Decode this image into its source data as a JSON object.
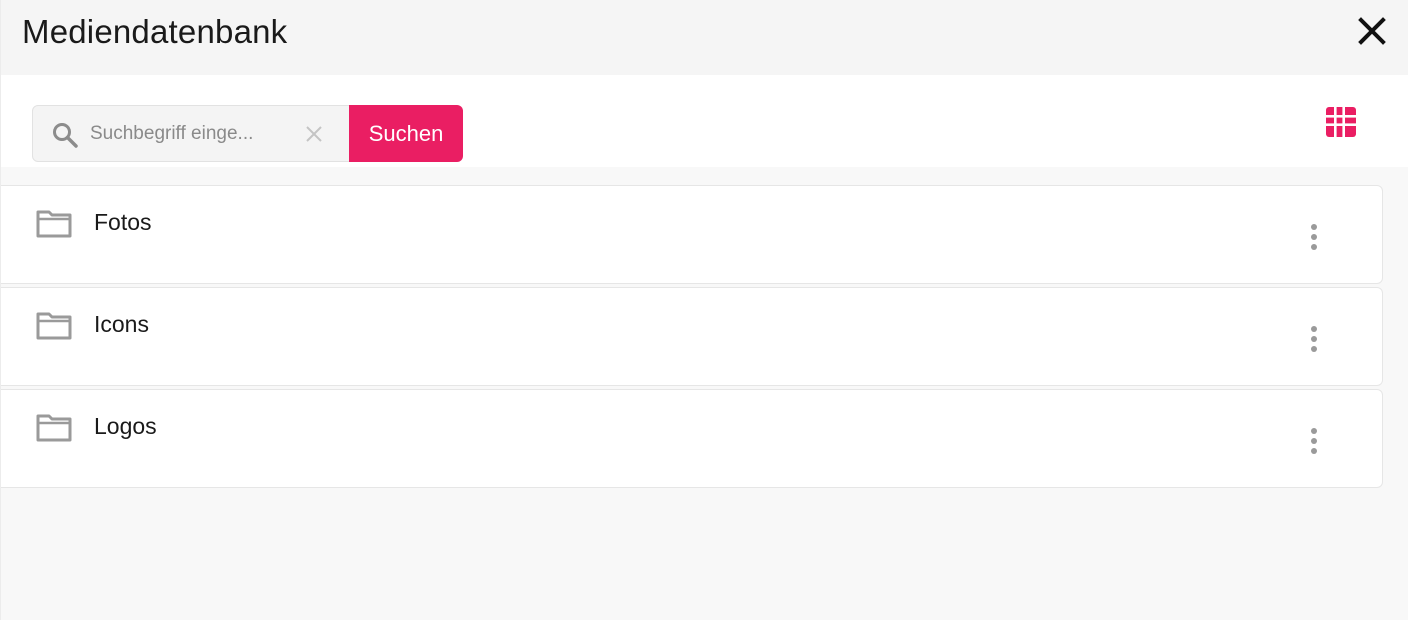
{
  "header": {
    "title": "Mediendatenbank",
    "close_icon": "close-icon"
  },
  "toolbar": {
    "search": {
      "placeholder": "Suchbegriff einge...",
      "value": "",
      "icon": "search-icon",
      "clear_icon": "clear-icon"
    },
    "submit_label": "Suchen",
    "view_toggle_icon": "grid-view-icon"
  },
  "folders": [
    {
      "name": "Fotos",
      "icon": "folder-icon",
      "menu_icon": "more-vertical-icon"
    },
    {
      "name": "Icons",
      "icon": "folder-icon",
      "menu_icon": "more-vertical-icon"
    },
    {
      "name": "Logos",
      "icon": "folder-icon",
      "menu_icon": "more-vertical-icon"
    }
  ],
  "colors": {
    "accent": "#ea1e63",
    "header_bg": "#f5f5f5",
    "page_bg": "#f8f8f8",
    "icon_gray": "#9a9a9a"
  }
}
